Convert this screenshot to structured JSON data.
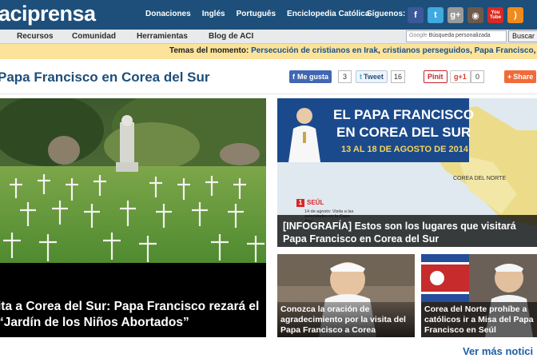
{
  "header": {
    "logo": "aciprensa",
    "nav": [
      "Donaciones",
      "Inglés",
      "Português",
      "Enciclopedia Católica"
    ],
    "follow_label": "Síguenos:",
    "social": [
      {
        "name": "facebook-icon",
        "glyph": "f",
        "color": "#3b5998"
      },
      {
        "name": "twitter-icon",
        "glyph": "t",
        "color": "#3fa9e0"
      },
      {
        "name": "googleplus-icon",
        "glyph": "g+",
        "color": "#9a9a9a"
      },
      {
        "name": "instagram-icon",
        "glyph": "◉",
        "color": "#6d5a4a"
      },
      {
        "name": "youtube-icon",
        "glyph": "You Tube",
        "color": "#d82a22"
      },
      {
        "name": "rss-icon",
        "glyph": ")",
        "color": "#f08a1c"
      }
    ]
  },
  "subnav": {
    "items": [
      "Recursos",
      "Comunidad",
      "Herramientas",
      "Blog de ACI"
    ],
    "search_brand": "Google",
    "search_placeholder": "Búsqueda personalizada",
    "search_button": "Buscar"
  },
  "trending": {
    "label": "Temas del momento:",
    "links": [
      "Persecución de cristianos en Irak",
      "cristianos perseguidos",
      "Papa Francisco",
      "M"
    ]
  },
  "titlebar": {
    "title": "Papa Francisco en Corea del Sur",
    "like_label": "Me gusta",
    "like_count": "3",
    "tweet_label": "Tweet",
    "tweet_count": "16",
    "pinit_label": "Pinit",
    "gplus_label": "g+1",
    "gplus_count": "0",
    "share_label": "Share"
  },
  "hero": {
    "caption": "ita a Corea del Sur: Papa Francisco rezará el “Jardín de los Niños Abortados”"
  },
  "infographic": {
    "banner_line1": "EL PAPA FRANCISCO",
    "banner_line2": "EN COREA DEL SUR",
    "banner_date": "13 AL 18 DE AGOSTO DE 2014",
    "map_label": "COREA DEL NORTE",
    "map_num": "1",
    "map_city": "SEÚL",
    "map_note": "14 de agosto: Visita a las autoridades en la Casa Azul",
    "caption": "[INFOGRAFÍA] Estos son los lugares que visitará Papa Francisco en Corea del Sur"
  },
  "tiles": [
    {
      "caption": "Conozca la oración de agradecimiento por la visita del Papa Francisco a Corea"
    },
    {
      "caption": "Corea del Norte prohíbe a católicos ir a Misa del Papa Francisco en Seúl"
    }
  ],
  "more_link": "Ver más notici"
}
